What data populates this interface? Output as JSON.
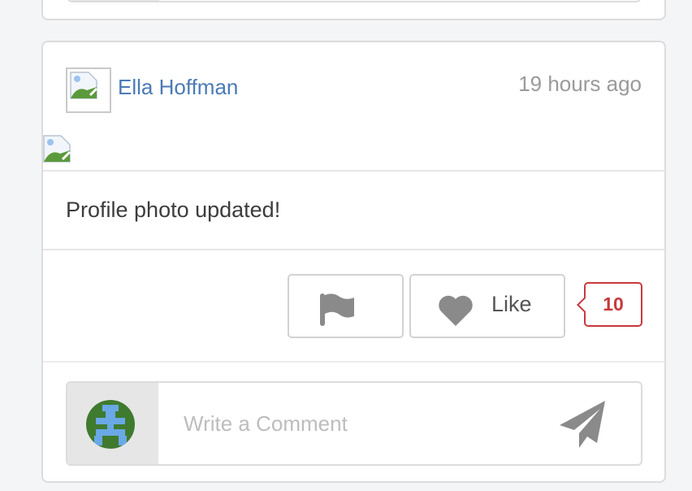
{
  "post": {
    "author_name": "Ella Hoffman",
    "timestamp": "19 hours ago",
    "text": "Profile photo updated!"
  },
  "actions": {
    "flag_icon": "flag-icon",
    "like_icon": "heart-icon",
    "like_label": "Like",
    "like_count": "10"
  },
  "comment": {
    "placeholder": "Write a Comment",
    "send_icon": "paper-plane-icon"
  },
  "colors": {
    "author_link": "#4a7ab5",
    "like_count": "#c8383c",
    "icon_gray": "#8a8a8a",
    "avatar_green": "#3f7a2e",
    "avatar_blue": "#6aa8e6"
  }
}
